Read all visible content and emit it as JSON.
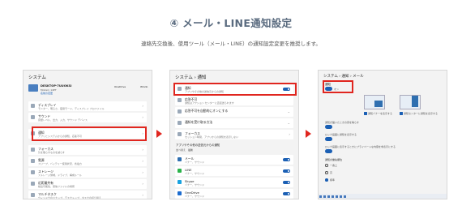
{
  "header": {
    "title": "④ メール・LINE通知設定",
    "subtitle": "連絡先交換後、使用ツール（メール・LINE）の通知設定変更を推奨します。"
  },
  "panel1": {
    "title": "システム",
    "device_name": "DESKTOP-7UUOKSI",
    "device_sub1": "Modern 14PT",
    "device_sub2": "名前の変更",
    "onedrive": "OneDrive",
    "windows": "Windo",
    "rows": [
      {
        "label": "ディスプレイ",
        "sub": "モニター、明るさ、夜間モード、ディスプレイ プロファイル"
      },
      {
        "label": "サウンド",
        "sub": "音量レベル、出力、入力、サウンド デバイス"
      },
      {
        "label": "通知",
        "sub": "アプリとシステムからの通知、応答不可"
      },
      {
        "label": "フォーカス",
        "sub": "気を散らすものを減らす"
      },
      {
        "label": "電源",
        "sub": "スリープ、バッテリー使用状況、省電力"
      },
      {
        "label": "ストレージ",
        "sub": "ストレージ領域、ドライブ、構成ルール"
      },
      {
        "label": "近距離共有",
        "sub": "検出可能性、受信ファイルの場所"
      },
      {
        "label": "マルチタスク",
        "sub": "ウィンドウのスナップ、デスクトップ、タスクの切り替え"
      }
    ]
  },
  "panel2": {
    "title": "システム › 通知",
    "rows": [
      {
        "label": "通知",
        "sub": "アプリやその他の送信元からの通知"
      },
      {
        "label": "応答不可",
        "sub": "通知はアクション センターに直接送られます"
      },
      {
        "label": "応答不可を自動的にオンにする",
        "sub": ""
      },
      {
        "label": "通知を受け取る方法",
        "sub": ""
      },
      {
        "label": "フォーカス",
        "sub": "セッション時間、アプリからの通知を表示しない"
      }
    ],
    "section": "アプリやその他の送信元からの通知",
    "sort_label": "並べ替え",
    "sort_value": "最新",
    "apps": [
      {
        "label": "メール",
        "sub": "バナー、サウンド"
      },
      {
        "label": "LINE",
        "sub": "バナー、サウンド"
      },
      {
        "label": "Skype",
        "sub": "バナー、サウンド"
      },
      {
        "label": "OneDrive",
        "sub": "バナー、サウンド"
      }
    ]
  },
  "panel3": {
    "title": "システム › 通知 › メール",
    "notify_label": "通知",
    "toggle_state": "オン",
    "banner_label": "通知バナーを表示する",
    "center_label": "通知センターに通知を表示する",
    "options": [
      "通知が届いたときの音を鳴らす",
      "ロック画面に通知を表示する",
      "ロック画面に表示するときにプライベートな内容を非表示にする",
      "通知の優先順位",
      "一番上",
      "高",
      "標準"
    ]
  },
  "colors": {
    "accent_red": "#e0261f",
    "toggle_blue": "#1a5fb4",
    "title_gray": "#5a6b7f"
  }
}
